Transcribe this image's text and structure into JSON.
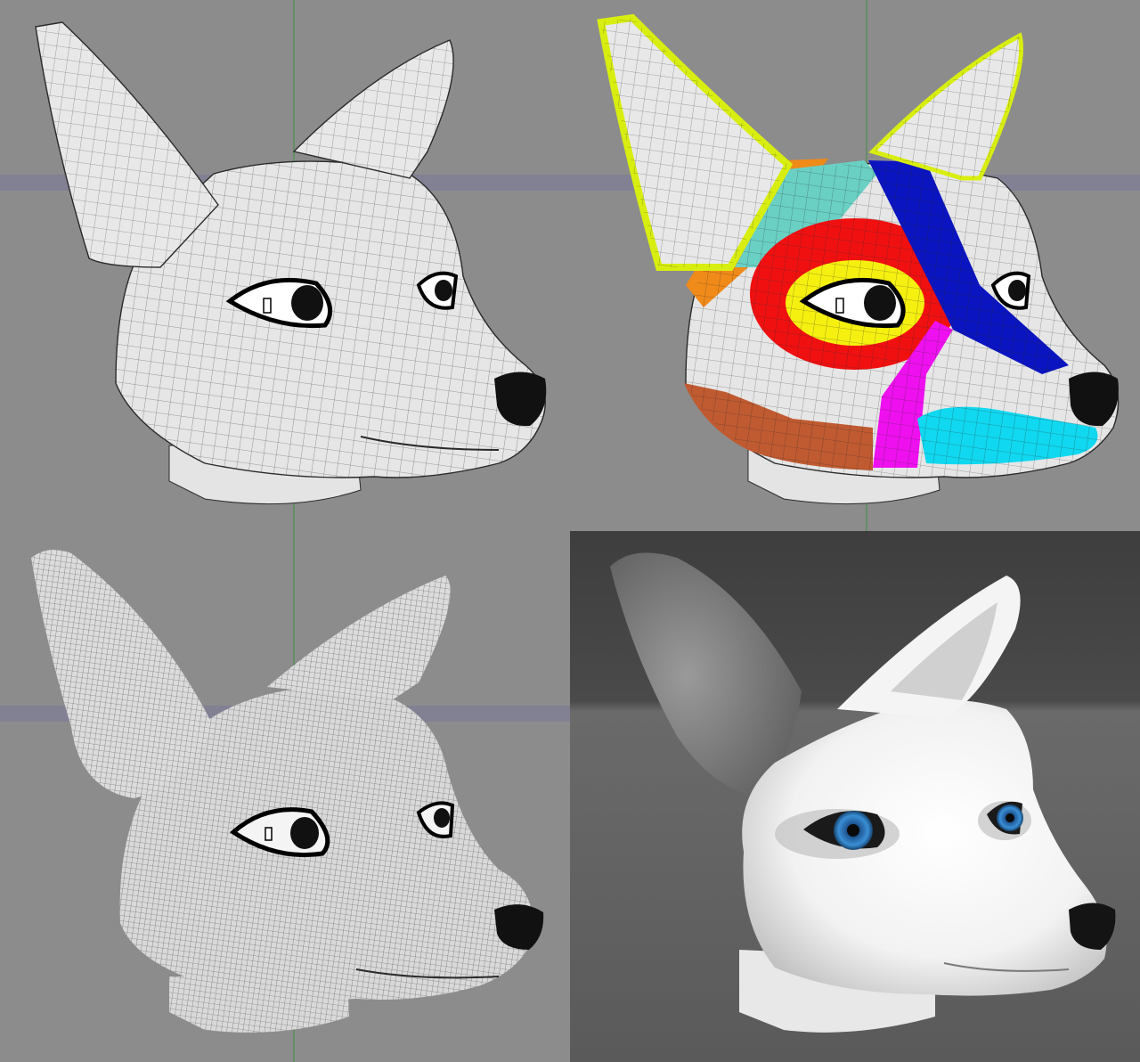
{
  "panels": [
    {
      "id": "wireframe-lowpoly",
      "viewport": "3d",
      "shading": "wireframe-gray"
    },
    {
      "id": "wireframe-colored-loops",
      "viewport": "3d",
      "shading": "edge-loops-colored"
    },
    {
      "id": "wireframe-subdivided",
      "viewport": "3d",
      "shading": "dense-wireframe"
    },
    {
      "id": "render-final",
      "viewport": "render",
      "shading": "white-clay",
      "eye_color": "#3a8fd6"
    }
  ],
  "colors": {
    "viewport_bg": "#8c8c8c",
    "floor": "#9b9b9b",
    "horizon_band": "#7d7a96",
    "axis_line": "#3f8f3f",
    "mesh_fill": "#e6e6e6",
    "mesh_line": "#2a2a2a",
    "render_bg_top": "#4a4a4a",
    "render_bg_floor": "#6a6a6a",
    "loop_yellow_green": "#d8ee10",
    "loop_orange": "#f08a18",
    "loop_teal": "#6ad0c4",
    "loop_red": "#f01010",
    "loop_yellow": "#f6f010",
    "loop_blue": "#0a14c0",
    "loop_magenta": "#ee10ee",
    "loop_cyan": "#10d8f0",
    "loop_brown": "#c05a30"
  }
}
